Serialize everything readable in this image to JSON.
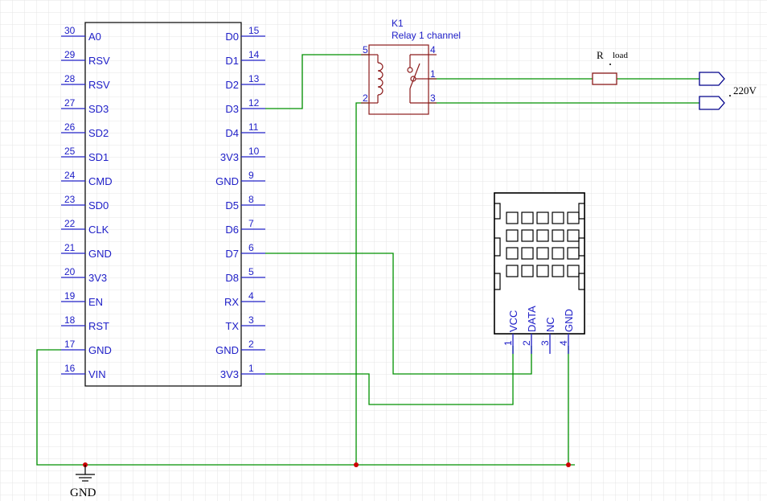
{
  "mcu": {
    "left_pins": [
      {
        "num": "30",
        "label": "A0"
      },
      {
        "num": "29",
        "label": "RSV"
      },
      {
        "num": "28",
        "label": "RSV"
      },
      {
        "num": "27",
        "label": "SD3"
      },
      {
        "num": "26",
        "label": "SD2"
      },
      {
        "num": "25",
        "label": "SD1"
      },
      {
        "num": "24",
        "label": "CMD"
      },
      {
        "num": "23",
        "label": "SD0"
      },
      {
        "num": "22",
        "label": "CLK"
      },
      {
        "num": "21",
        "label": "GND"
      },
      {
        "num": "20",
        "label": "3V3"
      },
      {
        "num": "19",
        "label": "EN"
      },
      {
        "num": "18",
        "label": "RST"
      },
      {
        "num": "17",
        "label": "GND"
      },
      {
        "num": "16",
        "label": "VIN"
      }
    ],
    "right_pins": [
      {
        "num": "15",
        "label": "D0"
      },
      {
        "num": "14",
        "label": "D1"
      },
      {
        "num": "13",
        "label": "D2"
      },
      {
        "num": "12",
        "label": "D3"
      },
      {
        "num": "11",
        "label": "D4"
      },
      {
        "num": "10",
        "label": "3V3"
      },
      {
        "num": "9",
        "label": "GND"
      },
      {
        "num": "8",
        "label": "D5"
      },
      {
        "num": "7",
        "label": "D6"
      },
      {
        "num": "6",
        "label": "D7"
      },
      {
        "num": "5",
        "label": "D8"
      },
      {
        "num": "4",
        "label": "RX"
      },
      {
        "num": "3",
        "label": "TX"
      },
      {
        "num": "2",
        "label": "GND"
      },
      {
        "num": "1",
        "label": "3V3"
      }
    ]
  },
  "relay": {
    "designator": "K1",
    "name": "Relay 1 channel",
    "pins": {
      "p5": "5",
      "p4": "4",
      "p1": "1",
      "p2": "2",
      "p3": "3"
    }
  },
  "resistor": {
    "designator": "R",
    "subscript": "load"
  },
  "supply": {
    "label": "220V"
  },
  "sensor": {
    "pins": [
      {
        "num": "1",
        "label": "VCC"
      },
      {
        "num": "2",
        "label": "DATA"
      },
      {
        "num": "3",
        "label": "NC"
      },
      {
        "num": "4",
        "label": "GND"
      }
    ]
  },
  "ground": {
    "label": "GND"
  },
  "colors": {
    "wire": "#009100",
    "body": "#8b1a1a",
    "pin_text": "#2020c8",
    "junction": "#cc0000",
    "grid": "#e6e6e6"
  }
}
